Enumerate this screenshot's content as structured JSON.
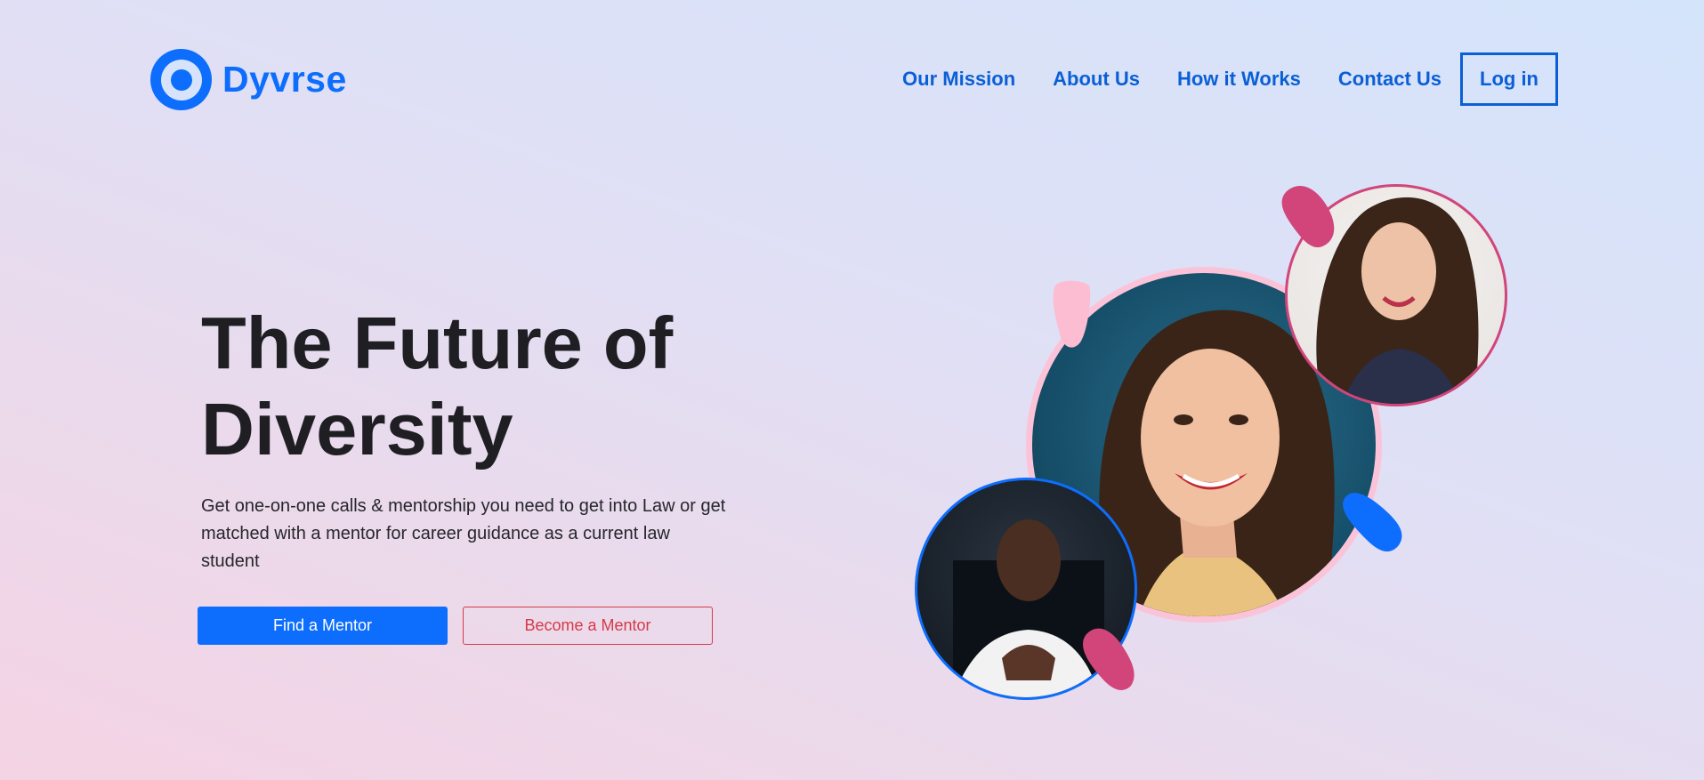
{
  "header": {
    "brand": "Dyvrse",
    "nav": [
      "Our Mission",
      "About Us",
      "How it Works",
      "Contact Us"
    ],
    "login": "Log in"
  },
  "hero": {
    "title_line1": "The Future of",
    "title_line2": "Diversity",
    "subtitle": "Get one-on-one calls & mentorship you need to get into Law or get matched with a mentor for career guidance as a current law student",
    "primary_button": "Find a Mentor",
    "secondary_button": "Become a Mentor"
  },
  "colors": {
    "brand_blue": "#0d6efd",
    "accent_red": "#d63a47",
    "accent_pink": "#d1457a",
    "light_pink": "#fbc3d8"
  }
}
